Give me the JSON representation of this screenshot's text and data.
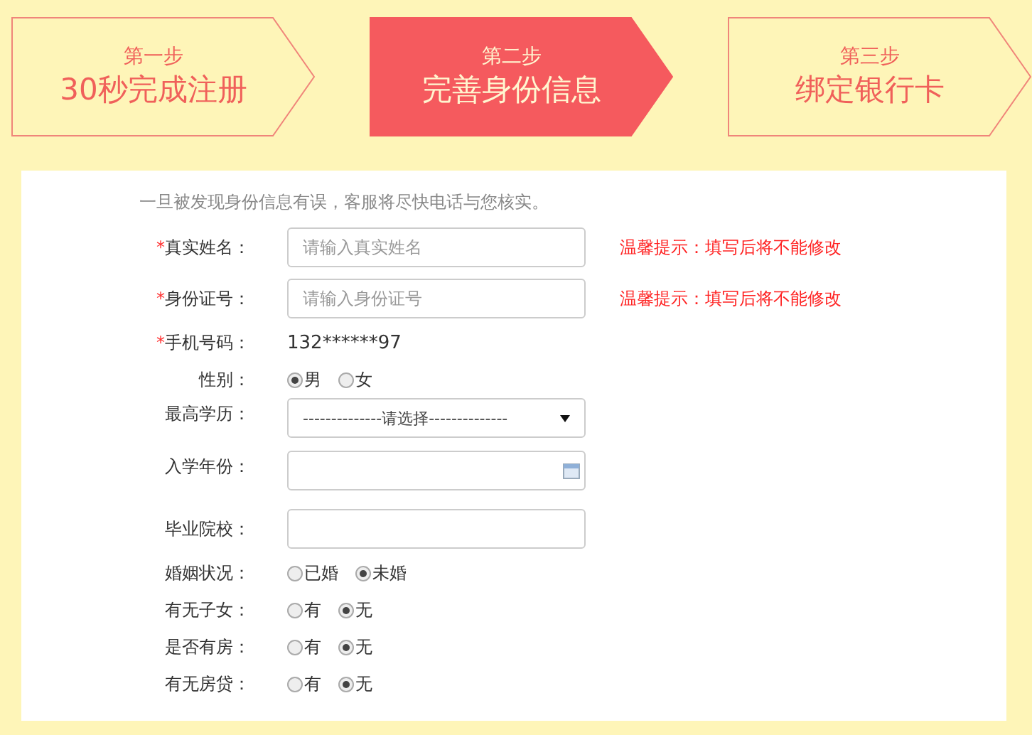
{
  "steps": [
    {
      "step": "第一步",
      "title": "30秒完成注册",
      "selected": false
    },
    {
      "step": "第二步",
      "title": "完善身份信息",
      "selected": true
    },
    {
      "step": "第三步",
      "title": "绑定银行卡",
      "selected": false
    }
  ],
  "notice": "一旦被发现身份信息有误，客服将尽快电话与您核实。",
  "fields": [
    {
      "kind": "text",
      "label": "真实姓名：",
      "required_mark": "*",
      "placeholder": "请输入真实姓名",
      "hint": "温馨提示：填写后将不能修改"
    },
    {
      "kind": "text",
      "label": "身份证号：",
      "required_mark": "*",
      "placeholder": "请输入身份证号",
      "hint": "温馨提示：填写后将不能修改"
    },
    {
      "kind": "static",
      "label": "手机号码：",
      "required_mark": "*",
      "value": "132******97"
    },
    {
      "kind": "radio",
      "label": "性别：",
      "options": [
        {
          "label": "男",
          "selected": true
        },
        {
          "label": "女",
          "selected": false
        }
      ]
    },
    {
      "kind": "select",
      "label": "最高学历：",
      "value": "--------------请选择--------------"
    },
    {
      "kind": "date",
      "label": "入学年份："
    },
    {
      "kind": "input",
      "label": "毕业院校："
    },
    {
      "kind": "radio",
      "label": "婚姻状况：",
      "options": [
        {
          "label": "已婚",
          "selected": false
        },
        {
          "label": "未婚",
          "selected": true
        }
      ]
    },
    {
      "kind": "radio",
      "label": "有无子女：",
      "options": [
        {
          "label": "有",
          "selected": false
        },
        {
          "label": "无",
          "selected": true
        }
      ]
    },
    {
      "kind": "radio",
      "label": "是否有房：",
      "options": [
        {
          "label": "有",
          "selected": false
        },
        {
          "label": "无",
          "selected": true
        }
      ]
    },
    {
      "kind": "radio",
      "label": "有无房贷：",
      "options": [
        {
          "label": "有",
          "selected": false
        },
        {
          "label": "无",
          "selected": true
        }
      ]
    }
  ]
}
